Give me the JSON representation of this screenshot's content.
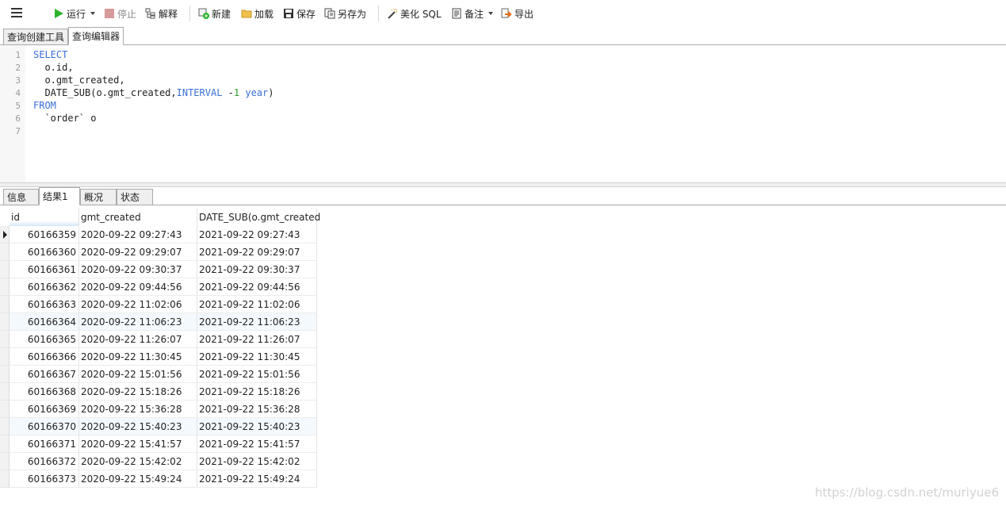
{
  "toolbar": {
    "run": "运行",
    "stop": "停止",
    "explain": "解释",
    "new": "新建",
    "load": "加载",
    "save": "保存",
    "save_as": "另存为",
    "beautify": "美化 SQL",
    "note": "备注",
    "export": "导出"
  },
  "query_tabs": [
    "查询创建工具",
    "查询编辑器"
  ],
  "editor": {
    "lines": [
      {
        "n": "1",
        "text": "SELECT"
      },
      {
        "n": "2",
        "text": "  o.id,"
      },
      {
        "n": "3",
        "text": "  o.gmt_created,"
      },
      {
        "n": "4",
        "text": "  DATE_SUB(o.gmt_created,INTERVAL -1 year)"
      },
      {
        "n": "5",
        "text": "FROM"
      },
      {
        "n": "6",
        "text": "  `order` o"
      },
      {
        "n": "7",
        "text": ""
      }
    ],
    "line4_parts": [
      "  DATE_SUB(o.gmt_created,",
      "INTERVAL",
      " -",
      "1",
      " ",
      "year",
      ")"
    ]
  },
  "result_tabs": [
    "信息",
    "结果1",
    "概况",
    "状态"
  ],
  "grid": {
    "columns": [
      "id",
      "gmt_created",
      "DATE_SUB(o.gmt_created"
    ],
    "rows": [
      [
        "60166359",
        "2020-09-22 09:27:43",
        "2021-09-22 09:27:43"
      ],
      [
        "60166360",
        "2020-09-22 09:29:07",
        "2021-09-22 09:29:07"
      ],
      [
        "60166361",
        "2020-09-22 09:30:37",
        "2021-09-22 09:30:37"
      ],
      [
        "60166362",
        "2020-09-22 09:44:56",
        "2021-09-22 09:44:56"
      ],
      [
        "60166363",
        "2020-09-22 11:02:06",
        "2021-09-22 11:02:06"
      ],
      [
        "60166364",
        "2020-09-22 11:06:23",
        "2021-09-22 11:06:23"
      ],
      [
        "60166365",
        "2020-09-22 11:26:07",
        "2021-09-22 11:26:07"
      ],
      [
        "60166366",
        "2020-09-22 11:30:45",
        "2021-09-22 11:30:45"
      ],
      [
        "60166367",
        "2020-09-22 15:01:56",
        "2021-09-22 15:01:56"
      ],
      [
        "60166368",
        "2020-09-22 15:18:26",
        "2021-09-22 15:18:26"
      ],
      [
        "60166369",
        "2020-09-22 15:36:28",
        "2021-09-22 15:36:28"
      ],
      [
        "60166370",
        "2020-09-22 15:40:23",
        "2021-09-22 15:40:23"
      ],
      [
        "60166371",
        "2020-09-22 15:41:57",
        "2021-09-22 15:41:57"
      ],
      [
        "60166372",
        "2020-09-22 15:42:02",
        "2021-09-22 15:42:02"
      ],
      [
        "60166373",
        "2020-09-22 15:49:24",
        "2021-09-22 15:49:24"
      ]
    ]
  },
  "watermark": "https://blog.csdn.net/muriyue6",
  "colors": {
    "keyword": "#3a6fd8",
    "number": "#2a9a2a",
    "run_icon": "#2bb32b",
    "alt_row": "#f4f9fd"
  }
}
